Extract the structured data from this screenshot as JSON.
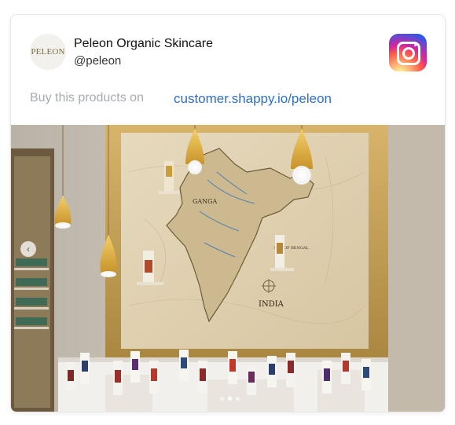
{
  "post": {
    "account_name": "Peleon Organic Skincare",
    "handle": "@peleon",
    "avatar_text": "PELEON",
    "buy_label": "Buy this products on",
    "shop_link": "customer.shappy.io/peleon",
    "platform_icon": "instagram-icon"
  },
  "photo": {
    "map_labels": {
      "region": "GANGA",
      "bay": "BAY OF BENGAL",
      "country": "INDIA"
    },
    "carousel_dots": 3,
    "active_dot": 1
  }
}
